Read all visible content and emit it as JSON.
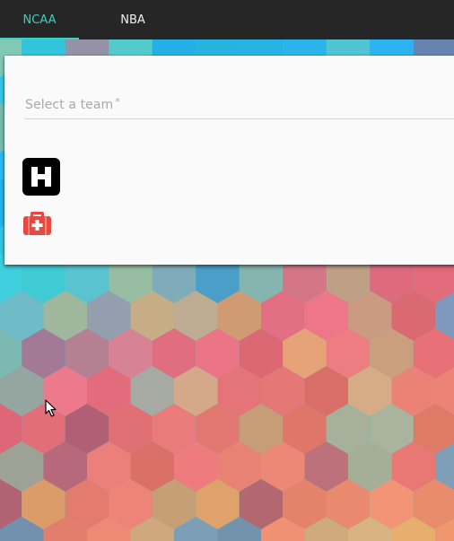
{
  "tabs": [
    {
      "label": "NCAA",
      "active": true
    },
    {
      "label": "NBA",
      "active": false
    }
  ],
  "team_select": {
    "placeholder": "Select a team",
    "required_mark": "*"
  },
  "icons": {
    "hospital": "hospital-letter-h-icon",
    "medical_kit": "medical-kit-icon",
    "cursor": "mouse-pointer"
  },
  "colors": {
    "nav_background": "#262626",
    "active_tab": "#37d3c0",
    "card_background": "#fafafa",
    "medical_kit": "#e8493f"
  }
}
